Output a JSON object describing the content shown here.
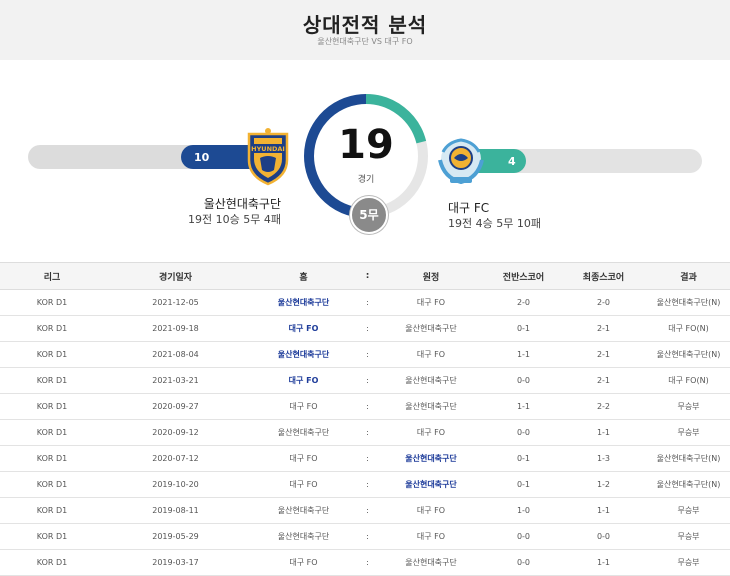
{
  "header": {
    "title": "상대전적 분석",
    "subtitle": "울산현대축구단 VS 대구 FO"
  },
  "summary": {
    "total_games": "19",
    "games_label": "경기",
    "draws_label": "5무",
    "home": {
      "name": "울산현대축구단",
      "record": "19전 10승 5무 4패",
      "wins": "10"
    },
    "away": {
      "name": "대구 FC",
      "record": "19전 4승 5무 10패",
      "wins": "4"
    }
  },
  "colors": {
    "home": "#1d4a93",
    "away": "#3bb39c",
    "draw": "#8a8a8a"
  },
  "table": {
    "headers": [
      "리그",
      "경기일자",
      "홈",
      ":",
      "원정",
      "전반스코어",
      "최종스코어",
      "결과"
    ],
    "rows": [
      {
        "league": "KOR D1",
        "date": "2021-12-05",
        "home": "울산현대축구단",
        "sep": ":",
        "away": "대구 FO",
        "half": "2-0",
        "final": "2-0",
        "result": "울산현대축구단(N)",
        "winner": "home"
      },
      {
        "league": "KOR D1",
        "date": "2021-09-18",
        "home": "대구 FO",
        "sep": ":",
        "away": "울산현대축구단",
        "half": "0-1",
        "final": "2-1",
        "result": "대구 FO(N)",
        "winner": "home"
      },
      {
        "league": "KOR D1",
        "date": "2021-08-04",
        "home": "울산현대축구단",
        "sep": ":",
        "away": "대구 FO",
        "half": "1-1",
        "final": "2-1",
        "result": "울산현대축구단(N)",
        "winner": "home"
      },
      {
        "league": "KOR D1",
        "date": "2021-03-21",
        "home": "대구 FO",
        "sep": ":",
        "away": "울산현대축구단",
        "half": "0-0",
        "final": "2-1",
        "result": "대구 FO(N)",
        "winner": "home"
      },
      {
        "league": "KOR D1",
        "date": "2020-09-27",
        "home": "대구 FO",
        "sep": ":",
        "away": "울산현대축구단",
        "half": "1-1",
        "final": "2-2",
        "result": "무승부",
        "winner": "none"
      },
      {
        "league": "KOR D1",
        "date": "2020-09-12",
        "home": "울산현대축구단",
        "sep": ":",
        "away": "대구 FO",
        "half": "0-0",
        "final": "1-1",
        "result": "무승부",
        "winner": "none"
      },
      {
        "league": "KOR D1",
        "date": "2020-07-12",
        "home": "대구 FO",
        "sep": ":",
        "away": "울산현대축구단",
        "half": "0-1",
        "final": "1-3",
        "result": "울산현대축구단(N)",
        "winner": "away"
      },
      {
        "league": "KOR D1",
        "date": "2019-10-20",
        "home": "대구 FO",
        "sep": ":",
        "away": "울산현대축구단",
        "half": "0-1",
        "final": "1-2",
        "result": "울산현대축구단(N)",
        "winner": "away"
      },
      {
        "league": "KOR D1",
        "date": "2019-08-11",
        "home": "울산현대축구단",
        "sep": ":",
        "away": "대구 FO",
        "half": "1-0",
        "final": "1-1",
        "result": "무승부",
        "winner": "none"
      },
      {
        "league": "KOR D1",
        "date": "2019-05-29",
        "home": "울산현대축구단",
        "sep": ":",
        "away": "대구 FO",
        "half": "0-0",
        "final": "0-0",
        "result": "무승부",
        "winner": "none"
      },
      {
        "league": "KOR D1",
        "date": "2019-03-17",
        "home": "대구 FO",
        "sep": ":",
        "away": "울산현대축구단",
        "half": "0-0",
        "final": "1-1",
        "result": "무승부",
        "winner": "none"
      }
    ]
  }
}
